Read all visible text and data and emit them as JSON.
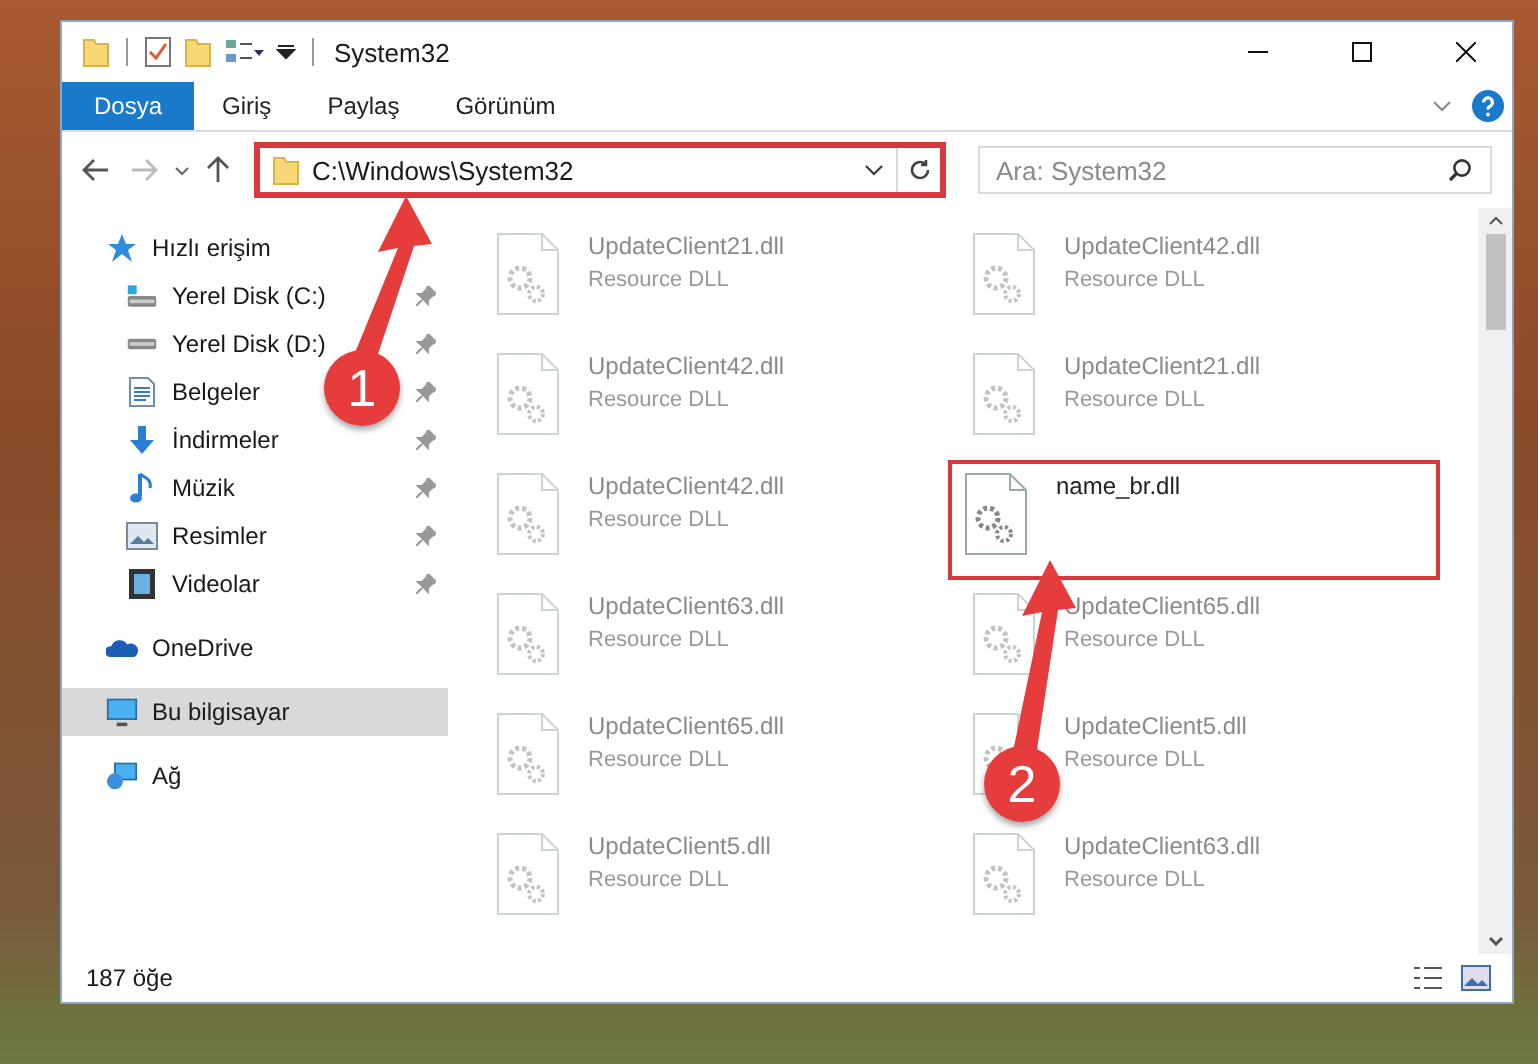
{
  "window": {
    "title": "System32"
  },
  "ribbon_tabs": [
    {
      "label": "Dosya",
      "selected": true
    },
    {
      "label": "Giriş",
      "selected": false
    },
    {
      "label": "Paylaş",
      "selected": false
    },
    {
      "label": "Görünüm",
      "selected": false
    }
  ],
  "address_bar": {
    "path": "C:\\Windows\\System32",
    "highlighted": true
  },
  "search": {
    "placeholder": "Ara: System32"
  },
  "nav_pane": [
    {
      "label": "Hızlı erişim",
      "kind": "star",
      "selected": false,
      "pinned": false,
      "children": [
        {
          "label": "Yerel Disk (C:)",
          "kind": "drive",
          "selected": false,
          "pinned": true
        },
        {
          "label": "Yerel Disk (D:)",
          "kind": "drive",
          "selected": false,
          "pinned": true
        },
        {
          "label": "Belgeler",
          "kind": "document",
          "selected": false,
          "pinned": true
        },
        {
          "label": "İndirmeler",
          "kind": "download",
          "selected": false,
          "pinned": true
        },
        {
          "label": "Müzik",
          "kind": "music",
          "selected": false,
          "pinned": true
        },
        {
          "label": "Resimler",
          "kind": "picture",
          "selected": false,
          "pinned": true
        },
        {
          "label": "Videolar",
          "kind": "video",
          "selected": false,
          "pinned": true
        }
      ]
    },
    {
      "label": "OneDrive",
      "kind": "cloud",
      "selected": false,
      "pinned": false
    },
    {
      "label": "Bu bilgisayar",
      "kind": "computer",
      "selected": true,
      "pinned": false
    },
    {
      "label": "Ağ",
      "kind": "network",
      "selected": false,
      "pinned": false
    }
  ],
  "files": [
    {
      "name": "UpdateClient21.dll",
      "type": "Resource DLL",
      "blurred": true,
      "highlighted": false
    },
    {
      "name": "UpdateClient42.dll",
      "type": "Resource DLL",
      "blurred": true,
      "highlighted": false
    },
    {
      "name": "UpdateClient42.dll",
      "type": "Resource DLL",
      "blurred": true,
      "highlighted": false
    },
    {
      "name": "UpdateClient21.dll",
      "type": "Resource DLL",
      "blurred": true,
      "highlighted": false
    },
    {
      "name": "UpdateClient42.dll",
      "type": "Resource DLL",
      "blurred": true,
      "highlighted": false
    },
    {
      "name": "name_br.dll",
      "blurred": false,
      "highlighted": true
    },
    {
      "name": "UpdateClient63.dll",
      "type": "Resource DLL",
      "blurred": true,
      "highlighted": false
    },
    {
      "name": "UpdateClient65.dll",
      "type": "Resource DLL",
      "blurred": true,
      "highlighted": false
    },
    {
      "name": "UpdateClient65.dll",
      "type": "Resource DLL",
      "blurred": true,
      "highlighted": false
    },
    {
      "name": "UpdateClient5.dll",
      "type": "Resource DLL",
      "blurred": true,
      "highlighted": false
    },
    {
      "name": "UpdateClient5.dll",
      "type": "Resource DLL",
      "blurred": true,
      "highlighted": false
    },
    {
      "name": "UpdateClient63.dll",
      "type": "Resource DLL",
      "blurred": true,
      "highlighted": false
    }
  ],
  "status_bar": {
    "item_count": "187 öğe"
  },
  "callouts": [
    {
      "number": "1"
    },
    {
      "number": "2"
    }
  ]
}
